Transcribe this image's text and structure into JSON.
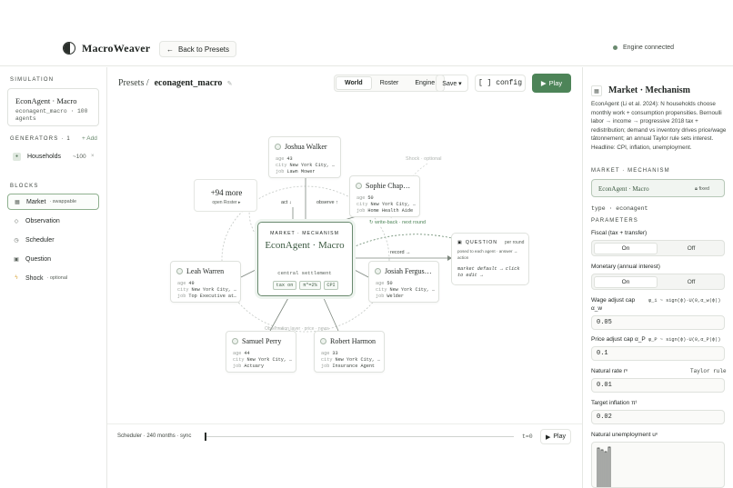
{
  "header": {
    "brand": "MacroWeaver",
    "back_label": "Back to Presets",
    "engine_status": "Engine connected"
  },
  "left": {
    "simulation_label": "SIMULATION",
    "sim_title": "EconAgent · Macro",
    "sim_sub": "econagent_macro · 100 agents",
    "generators_label": "GENERATORS · 1",
    "add_label": "+ Add",
    "generator": {
      "name": "Households",
      "count": "~100",
      "remove": "×"
    },
    "blocks_label": "BLOCKS",
    "blocks": [
      {
        "name": "Market",
        "note": "· swappable",
        "icon": "dot"
      },
      {
        "name": "Observation",
        "note": "",
        "icon": "diamond"
      },
      {
        "name": "Scheduler",
        "note": "",
        "icon": "clock"
      },
      {
        "name": "Question",
        "note": "",
        "icon": "square"
      },
      {
        "name": "Shock",
        "note": "· optional",
        "icon": "bolt"
      }
    ]
  },
  "center": {
    "breadcrumb_root": "Presets /",
    "breadcrumb_current": "econagent_macro",
    "view_tabs": [
      "World",
      "Roster",
      "Engine"
    ],
    "active_tab": "World",
    "save_label": "Save ▾",
    "config_label": "[ ] config",
    "play_label": "Play"
  },
  "graph": {
    "agents": [
      {
        "name": "Joshua Walker",
        "age": "43",
        "city": "New York City, …",
        "job": "Lawn Mower"
      },
      {
        "name": "Sophie Chap…",
        "age": "50",
        "city": "New York City, …",
        "job": "Home Health Aide"
      },
      {
        "name": "Leah Warren",
        "age": "49",
        "city": "New York City, …",
        "job": "Top Executive at…"
      },
      {
        "name": "Josiah Fergus…",
        "age": "50",
        "city": "New York City, …",
        "job": "Welder"
      },
      {
        "name": "Samuel Perry",
        "age": "44",
        "city": "New York City, …",
        "job": "Actuary"
      },
      {
        "name": "Robert Harmon",
        "age": "33",
        "city": "New York City, …",
        "job": "Insurance Agent"
      }
    ],
    "more": {
      "count": "+94 more",
      "sub": "open Roster ▸"
    },
    "mechanism": {
      "label": "MARKET · MECHANISM",
      "title": "EconAgent · Macro",
      "sub": "central settlement",
      "pills": [
        "tax on",
        "π*=2%",
        "CPI"
      ]
    },
    "question": {
      "label": "QUESTION",
      "round": "per round",
      "desc": "posed to each agent · answer → action",
      "code": "market default → click to edit →"
    },
    "edge_labels": {
      "act": "act ↓",
      "observe": "observe ↑",
      "writeback": "↻ write-back · next round",
      "record": "record →",
      "shock": "Shock · optional",
      "broadcast": "Observation layer · price · news"
    }
  },
  "scheduler": {
    "text": "Scheduler · 240 months · sync",
    "t_label": "t=0",
    "play_label": "Play"
  },
  "inspector": {
    "title": "Market · Mechanism",
    "description": "EconAgent (Li et al. 2024): N households choose monthly work + consumption propensities. Bernoulli labor → income → progressive 2018 tax + redistribution; demand vs inventory drives price/wage tâtonnement; an annual Taylor rule sets interest. Headline: CPI, inflation, unemployment.",
    "mechanism_label": "MARKET · MECHANISM",
    "mechanism_value": "EconAgent · Macro",
    "fixed_label": "fixed",
    "type_line": "type · econagent",
    "parameters_label": "PARAMETERS",
    "params": {
      "fiscal": {
        "label": "Fiscal (tax + transfer)",
        "on": "On",
        "off": "Off"
      },
      "monetary": {
        "label": "Monetary (annual interest)",
        "on": "On",
        "off": "Off"
      },
      "wage_cap": {
        "label": "Wage adjust cap α_w",
        "formula": "φ_i ~ sign(ϕ)·U(0,α_w|ϕ|)",
        "value": "0.05"
      },
      "price_cap": {
        "label": "Price adjust cap α_P",
        "formula": "φ_P ~ sign(ϕ)·U(0,α_P|ϕ|)",
        "value": "0.1"
      },
      "natural_rate": {
        "label": "Natural rate rⁿ",
        "note": "Taylor rule",
        "value": "0.01"
      },
      "target_inflation": {
        "label": "Target inflation πᵗ",
        "value": "0.02"
      },
      "natural_unemployment": {
        "label": "Natural unemployment uⁿ"
      }
    }
  },
  "colors": {
    "accent": "#4d8458",
    "accent_light": "#eef4ef",
    "border": "#dfe2dd",
    "text": "#1f2421"
  }
}
